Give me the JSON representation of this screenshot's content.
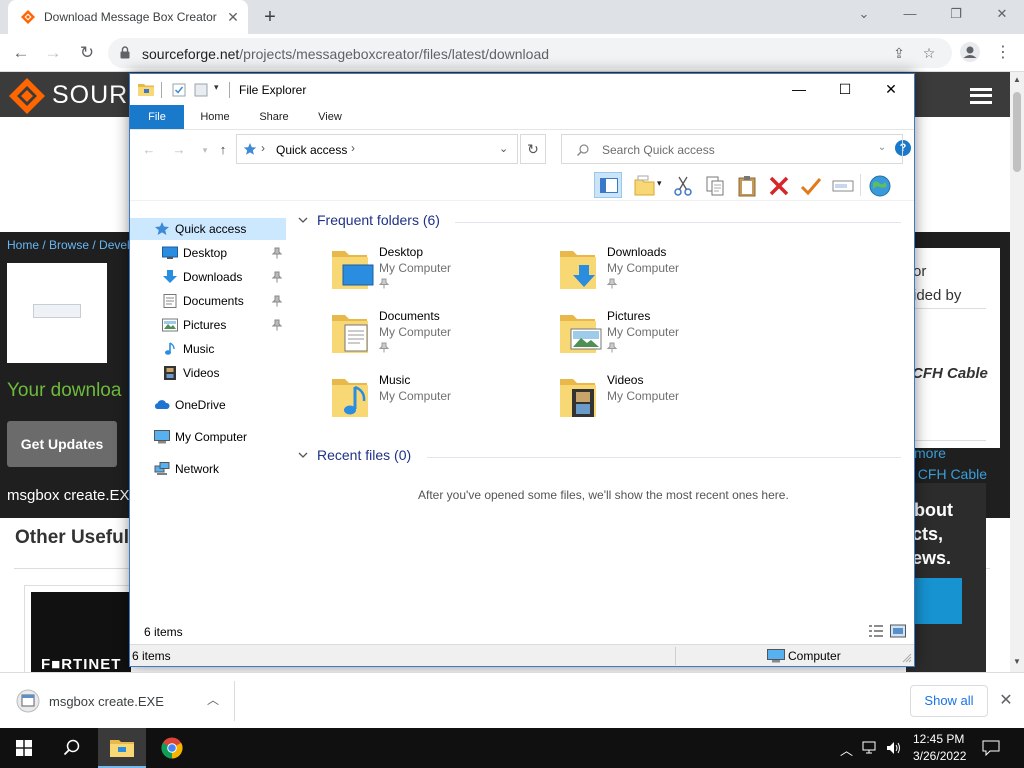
{
  "browser": {
    "tab_title": "Download Message Box Creator",
    "url_host": "sourceforge.net",
    "url_path": "/projects/messageboxcreator/files/latest/download"
  },
  "page": {
    "logo_text": "SOURCE",
    "breadcrumb": "Home / Browse / Devel",
    "download_text": "Your downloa",
    "get_updates": "Get Updates",
    "msgbox_link": "msgbox create.EX",
    "other_useful": "Other Useful B",
    "fortinet": "F■RTINET",
    "ad_line1": "or",
    "ad_line2": "ided by",
    "ad_logo": "CFH Cable",
    "ad_more": "more",
    "ad_cfh": "t CFH Cable",
    "about_1": "bout",
    "about_2": "cts,",
    "about_3": "ews."
  },
  "download_bar": {
    "file_name": "msgbox create.EXE",
    "show_all": "Show all"
  },
  "taskbar": {
    "time": "12:45 PM",
    "date": "3/26/2022"
  },
  "explorer": {
    "title": "File Explorer",
    "ribbon_tabs": [
      "File",
      "Home",
      "Share",
      "View"
    ],
    "address": "Quick access",
    "search_placeholder": "Search Quick access",
    "nav_items": [
      {
        "label": "Quick access",
        "icon": "star-icon",
        "pinned": false
      },
      {
        "label": "Desktop",
        "icon": "desktop-icon",
        "pinned": true
      },
      {
        "label": "Downloads",
        "icon": "download-arrow-icon",
        "pinned": true
      },
      {
        "label": "Documents",
        "icon": "documents-icon",
        "pinned": true
      },
      {
        "label": "Pictures",
        "icon": "pictures-icon",
        "pinned": true
      },
      {
        "label": "Music",
        "icon": "music-note-icon",
        "pinned": false
      },
      {
        "label": "Videos",
        "icon": "film-icon",
        "pinned": false
      },
      {
        "label": "OneDrive",
        "icon": "cloud-icon",
        "pinned": false
      },
      {
        "label": "My Computer",
        "icon": "computer-icon",
        "pinned": false
      },
      {
        "label": "Network",
        "icon": "network-icon",
        "pinned": false
      }
    ],
    "frequent_title": "Frequent folders (6)",
    "recent_title": "Recent files (0)",
    "folders": [
      {
        "name": "Desktop",
        "location": "My Computer",
        "pinned": true
      },
      {
        "name": "Downloads",
        "location": "My Computer",
        "pinned": true
      },
      {
        "name": "Documents",
        "location": "My Computer",
        "pinned": true
      },
      {
        "name": "Pictures",
        "location": "My Computer",
        "pinned": true
      },
      {
        "name": "Music",
        "location": "My Computer",
        "pinned": false
      },
      {
        "name": "Videos",
        "location": "My Computer",
        "pinned": false
      }
    ],
    "empty_recent": "After you've opened some files, we'll show the most recent ones here.",
    "items_count": "6 items",
    "status_count": "6 items",
    "status_zone": "Computer"
  },
  "colors": {
    "chrome_tabbar": "#dee1e6",
    "ribbon_accent": "#1979ca",
    "selection": "#cce8ff",
    "section_title": "#1e3287",
    "sf_orange": "#ff6600",
    "folder_yellow": "#f8d775"
  }
}
